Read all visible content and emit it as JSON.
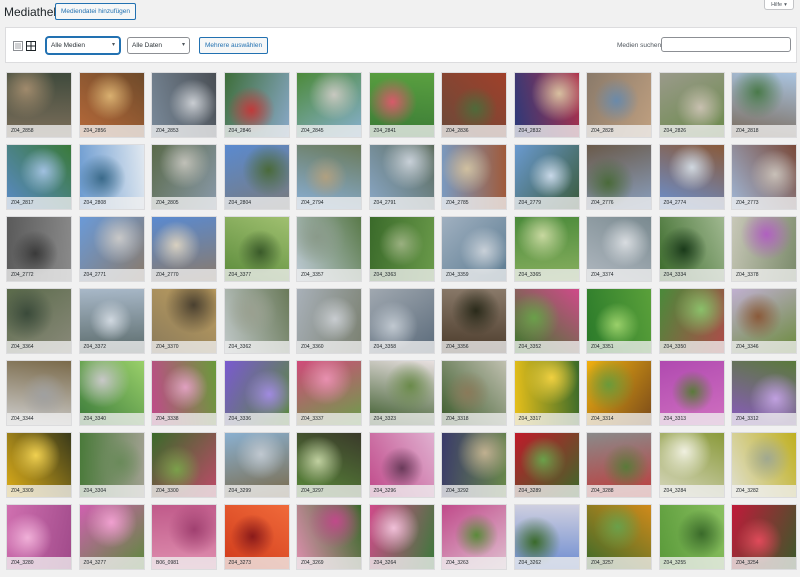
{
  "header": {
    "title": "Mediathek",
    "add_button": "Mediendatei hinzufügen",
    "help_label": "Hilfe",
    "help_icon": "triangle-down-icon"
  },
  "toolbar": {
    "view_icons": [
      "list-view-icon",
      "grid-view-icon"
    ],
    "media_filter": "Alle Medien",
    "date_filter": "Alle Daten",
    "bulk_select": "Mehrere auswählen",
    "search_label": "Medien suchen",
    "search_value": ""
  },
  "grid": {
    "items": [
      {
        "label": "Z04_2858",
        "colors": [
          "#7d6f5b",
          "#3f4a3c",
          "#a08a6c"
        ]
      },
      {
        "label": "Z04_2856",
        "colors": [
          "#b86a3a",
          "#6e4a2a",
          "#d9b070"
        ]
      },
      {
        "label": "Z04_2853",
        "colors": [
          "#7a8a9a",
          "#4a4f55",
          "#c9cdd2"
        ]
      },
      {
        "label": "Z04_2846",
        "colors": [
          "#3e6e3a",
          "#8aa9c9",
          "#c03a3a"
        ]
      },
      {
        "label": "Z04_2845",
        "colors": [
          "#4c8a3a",
          "#88b0d0",
          "#c8c8c0"
        ]
      },
      {
        "label": "Z04_2841",
        "colors": [
          "#3a7a36",
          "#5aa040",
          "#d85a6a"
        ]
      },
      {
        "label": "Z04_2836",
        "colors": [
          "#6a4a3a",
          "#a0402a",
          "#4f6a3a"
        ]
      },
      {
        "label": "Z04_2832",
        "colors": [
          "#2a3a7a",
          "#b0304a",
          "#d8c0a0"
        ]
      },
      {
        "label": "Z04_2828",
        "colors": [
          "#8a7a6a",
          "#c0a080",
          "#6a8aaa"
        ]
      },
      {
        "label": "Z04_2826",
        "colors": [
          "#9a9a8a",
          "#6a8a4a",
          "#c8c0b0"
        ]
      },
      {
        "label": "Z04_2818",
        "colors": [
          "#7a6a5a",
          "#aac4e0",
          "#4a7a4a"
        ]
      },
      {
        "label": "Z04_2817",
        "colors": [
          "#5a8ac8",
          "#3a7a3a",
          "#a0c0e0"
        ]
      },
      {
        "label": "Z04_2808",
        "colors": [
          "#6a9ad0",
          "#e0e8f0",
          "#3a6a8a"
        ]
      },
      {
        "label": "Z04_2805",
        "colors": [
          "#5a6a4a",
          "#8a9aaa",
          "#c0c0b8"
        ]
      },
      {
        "label": "Z04_2804",
        "colors": [
          "#5a8ad0",
          "#7a7a7a",
          "#4a6a3a"
        ]
      },
      {
        "label": "Z04_2794",
        "colors": [
          "#8ab0d8",
          "#6a7a5a",
          "#b0a080"
        ]
      },
      {
        "label": "Z04_2791",
        "colors": [
          "#8aa8c8",
          "#5a6a5a",
          "#c8d0d8"
        ]
      },
      {
        "label": "Z04_2785",
        "colors": [
          "#7a9ac0",
          "#a05a3a",
          "#d0c0a0"
        ]
      },
      {
        "label": "Z04_2779",
        "colors": [
          "#6a9ad0",
          "#3a5a3a",
          "#c8d8e8"
        ]
      },
      {
        "label": "Z04_2776",
        "colors": [
          "#6a5a4a",
          "#8aa0c0",
          "#4a6a3a"
        ]
      },
      {
        "label": "Z04_2774",
        "colors": [
          "#6a90d0",
          "#8a5a3a",
          "#d0d8e0"
        ]
      },
      {
        "label": "Z04_2773",
        "colors": [
          "#a0b8d8",
          "#7a4a3a",
          "#c8c0b8"
        ]
      },
      {
        "label": "Z04_2772",
        "colors": [
          "#5a5a5a",
          "#8a8a8a",
          "#3a3a3a"
        ]
      },
      {
        "label": "Z04_2771",
        "colors": [
          "#6a9ad8",
          "#8a7a6a",
          "#c8c8c8"
        ]
      },
      {
        "label": "Z04_2770",
        "colors": [
          "#5a8ad0",
          "#8a7a6a",
          "#d8d0c0"
        ]
      },
      {
        "label": "Z04_3377",
        "colors": [
          "#5a8a3a",
          "#a0c070",
          "#3a5a2a"
        ]
      },
      {
        "label": "Z04_3357",
        "colors": [
          "#c0ccd8",
          "#5a7a4a",
          "#8a9a8a"
        ]
      },
      {
        "label": "Z04_3363",
        "colors": [
          "#3a6a2a",
          "#6a9a4a",
          "#9ab080"
        ]
      },
      {
        "label": "Z04_3359",
        "colors": [
          "#a0b0c0",
          "#5a7a90",
          "#c8d0d8"
        ]
      },
      {
        "label": "Z04_3365",
        "colors": [
          "#4a8a3a",
          "#8ab060",
          "#c8d8a0"
        ]
      },
      {
        "label": "Z04_3374",
        "colors": [
          "#b0b8c0",
          "#7a8a90",
          "#d8dce0"
        ]
      },
      {
        "label": "Z04_3334",
        "colors": [
          "#3a6a2a",
          "#a0b890",
          "#1a3a1a"
        ]
      },
      {
        "label": "Z04_3378",
        "colors": [
          "#c8c8b8",
          "#7a8a6a",
          "#b060c0"
        ]
      },
      {
        "label": "Z04_3364",
        "colors": [
          "#5a6a4a",
          "#8a8a7a",
          "#3a4a3a"
        ]
      },
      {
        "label": "Z04_3372",
        "colors": [
          "#a8b8c8",
          "#5a6a6a",
          "#d0d8e0"
        ]
      },
      {
        "label": "Z04_3370",
        "colors": [
          "#8a7a5a",
          "#c0a060",
          "#4a4030"
        ]
      },
      {
        "label": "Z04_3362",
        "colors": [
          "#c0c8c8",
          "#6a7a5a",
          "#9aa090"
        ]
      },
      {
        "label": "Z04_3360",
        "colors": [
          "#a8b0b8",
          "#7a8070",
          "#c8ccd0"
        ]
      },
      {
        "label": "Z04_3358",
        "colors": [
          "#a0a8b0",
          "#5a6a7a",
          "#c0c8d0"
        ]
      },
      {
        "label": "Z04_3356",
        "colors": [
          "#4a3a2a",
          "#8a7a6a",
          "#2a2a1a"
        ]
      },
      {
        "label": "Z04_3352",
        "colors": [
          "#3a7a2a",
          "#d04a8a",
          "#6aa04a"
        ]
      },
      {
        "label": "Z04_3351",
        "colors": [
          "#2a7a2a",
          "#5aa03a",
          "#9ad06a"
        ]
      },
      {
        "label": "Z04_3350",
        "colors": [
          "#4a8a3a",
          "#b04a4a",
          "#8ac06a"
        ]
      },
      {
        "label": "Z04_3346",
        "colors": [
          "#c0b0d0",
          "#6a8a3a",
          "#8a5a3a"
        ]
      },
      {
        "label": "Z04_3344",
        "colors": [
          "#d0d0d0",
          "#7a6a4a",
          "#a0a0a0"
        ]
      },
      {
        "label": "Z04_3340",
        "colors": [
          "#3a7a3a",
          "#9ad06a",
          "#c8c8c8"
        ]
      },
      {
        "label": "Z04_3338",
        "colors": [
          "#c04a8a",
          "#6a9a3a",
          "#e0a0c0"
        ]
      },
      {
        "label": "Z04_3336",
        "colors": [
          "#7a5ad0",
          "#5a8a3a",
          "#a08ae0"
        ]
      },
      {
        "label": "Z04_3337",
        "colors": [
          "#d04a7a",
          "#6aa04a",
          "#e890b0"
        ]
      },
      {
        "label": "Z04_3323",
        "colors": [
          "#3a5a2a",
          "#e8e0e0",
          "#6a8a4a"
        ]
      },
      {
        "label": "Z04_3318",
        "colors": [
          "#3a5a2a",
          "#c0c0b0",
          "#8a7a5a"
        ]
      },
      {
        "label": "Z04_3317",
        "colors": [
          "#e8c01a",
          "#3a6a2a",
          "#f0d040"
        ]
      },
      {
        "label": "Z04_3314",
        "colors": [
          "#f0b010",
          "#7a4a1a",
          "#6a9a3a"
        ]
      },
      {
        "label": "Z04_3313",
        "colors": [
          "#b04ab0",
          "#d070c0",
          "#5a7a3a"
        ]
      },
      {
        "label": "Z04_3312",
        "colors": [
          "#8a5ac0",
          "#5a7a3a",
          "#c0a0e0"
        ]
      },
      {
        "label": "Z04_3309",
        "colors": [
          "#e0b01a",
          "#3a3a1a",
          "#f0d050"
        ]
      },
      {
        "label": "Z04_3304",
        "colors": [
          "#4a7a3a",
          "#a0a090",
          "#6a8a5a"
        ]
      },
      {
        "label": "Z04_3300",
        "colors": [
          "#3a6a2a",
          "#c04a6a",
          "#7aa04a"
        ]
      },
      {
        "label": "Z04_3299",
        "colors": [
          "#8ab0d0",
          "#7a6a4a",
          "#c0c8d0"
        ]
      },
      {
        "label": "Z04_3297",
        "colors": [
          "#5a8a3a",
          "#3a3a2a",
          "#c0d0a0"
        ]
      },
      {
        "label": "Z04_3296",
        "colors": [
          "#c04a8a",
          "#e0b0d0",
          "#6a3a5a"
        ]
      },
      {
        "label": "Z04_3292",
        "colors": [
          "#3a3a6a",
          "#6a8a4a",
          "#c0b090"
        ]
      },
      {
        "label": "Z04_3289",
        "colors": [
          "#c01a2a",
          "#3a6a2a",
          "#6aa04a"
        ]
      },
      {
        "label": "Z04_3288",
        "colors": [
          "#8a8a8a",
          "#c03a3a",
          "#5a7a3a"
        ]
      },
      {
        "label": "Z04_3284",
        "colors": [
          "#d8d8c0",
          "#8a9a3a",
          "#f0f0e0"
        ]
      },
      {
        "label": "Z04_3282",
        "colors": [
          "#e0e0d0",
          "#c0b020",
          "#a0a890"
        ]
      },
      {
        "label": "Z04_3280",
        "colors": [
          "#d070b0",
          "#a04a8a",
          "#f0b0d8"
        ]
      },
      {
        "label": "Z04_3277",
        "colors": [
          "#d060b0",
          "#5a8a3a",
          "#f0a0d0"
        ]
      },
      {
        "label": "B06_0981",
        "colors": [
          "#c05a8a",
          "#e090b0",
          "#a04070"
        ]
      },
      {
        "label": "Z04_3273",
        "colors": [
          "#d03a1a",
          "#f06a3a",
          "#8a1a1a"
        ]
      },
      {
        "label": "Z04_3269",
        "colors": [
          "#e090b0",
          "#3a6a2a",
          "#c04a8a"
        ]
      },
      {
        "label": "Z04_3264",
        "colors": [
          "#d04a8a",
          "#3a7a3a",
          "#f0c0d8"
        ]
      },
      {
        "label": "Z04_3263",
        "colors": [
          "#c04a8a",
          "#e0c0d0",
          "#5a8a3a"
        ]
      },
      {
        "label": "Z04_3262",
        "colors": [
          "#6a8ad0",
          "#d0d0e0",
          "#3a6a2a"
        ]
      },
      {
        "label": "Z04_3257",
        "colors": [
          "#3a6a2a",
          "#d08a1a",
          "#6aa04a"
        ]
      },
      {
        "label": "Z04_3255",
        "colors": [
          "#5a9a3a",
          "#8ac060",
          "#3a6a2a"
        ]
      },
      {
        "label": "Z04_3254",
        "colors": [
          "#c01a3a",
          "#3a5a2a",
          "#e04a5a"
        ]
      }
    ]
  }
}
